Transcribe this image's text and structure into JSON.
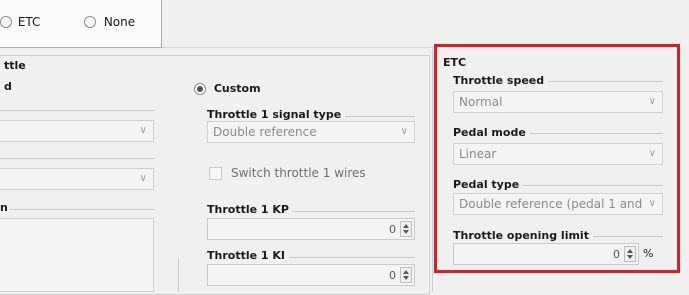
{
  "mode_selector": {
    "etc_label": "ETC",
    "none_label": "None"
  },
  "left_panel": {
    "title": "ttle",
    "subtitle": "d",
    "group_partial": "n",
    "custom_label": "Custom",
    "signal_type": {
      "title": "Throttle 1 signal type",
      "value": "Double reference"
    },
    "switch_wires_label": "Switch throttle 1 wires",
    "kp": {
      "title": "Throttle 1 KP",
      "value": "0"
    },
    "ki": {
      "title": "Throttle 1 KI",
      "value": "0"
    }
  },
  "etc_panel": {
    "title": "ETC",
    "throttle_speed": {
      "title": "Throttle speed",
      "value": "Normal"
    },
    "pedal_mode": {
      "title": "Pedal mode",
      "value": "Linear"
    },
    "pedal_type": {
      "title": "Pedal type",
      "value": "Double reference (pedal 1 and"
    },
    "opening_limit": {
      "title": "Throttle opening limit",
      "value": "0",
      "unit": "%"
    }
  },
  "colors": {
    "highlight": "#d4202a",
    "background": "#f0f0f0"
  }
}
